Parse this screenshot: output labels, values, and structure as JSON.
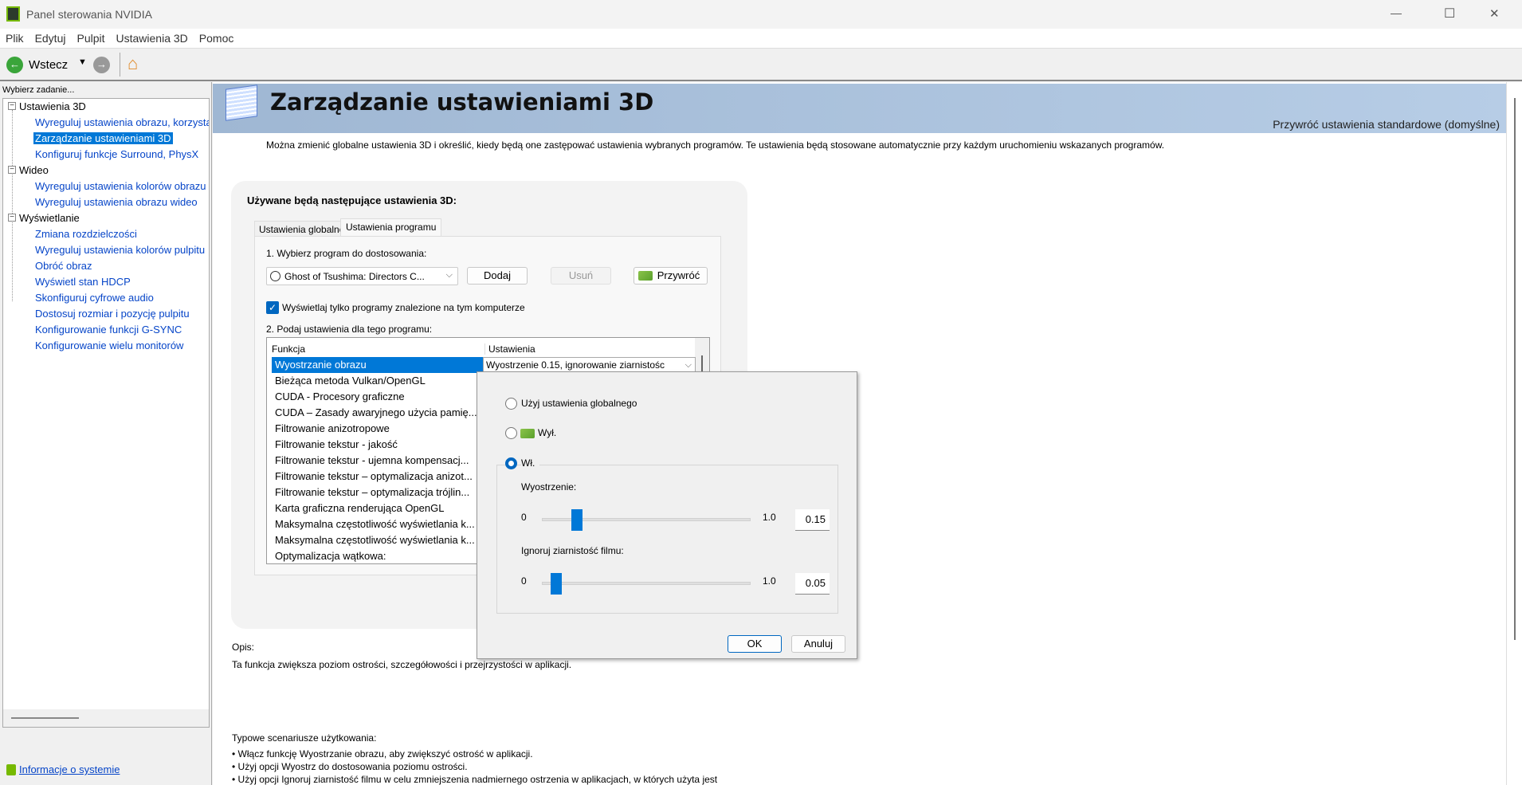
{
  "window": {
    "title": "Panel sterowania NVIDIA",
    "minimize": "—",
    "maximize": "☐",
    "close": "✕"
  },
  "menu": [
    "Plik",
    "Edytuj",
    "Pulpit",
    "Ustawienia 3D",
    "Pomoc"
  ],
  "toolbar": {
    "back": "Wstecz"
  },
  "sidebar": {
    "prompt": "Wybierz zadanie...",
    "groups": [
      {
        "label": "Ustawienia 3D",
        "items": [
          "Wyreguluj ustawienia obrazu, korzystając z podglądu",
          "Zarządzanie ustawieniami 3D",
          "Konfiguruj funkcje Surround, PhysX"
        ]
      },
      {
        "label": "Wideo",
        "items": [
          "Wyreguluj ustawienia kolorów obrazu",
          "Wyreguluj ustawienia obrazu wideo"
        ]
      },
      {
        "label": "Wyświetlanie",
        "items": [
          "Zmiana rozdzielczości",
          "Wyreguluj ustawienia kolorów pulpitu",
          "Obróć obraz",
          "Wyświetl stan HDCP",
          "Skonfiguruj cyfrowe audio",
          "Dostosuj rozmiar i pozycję pulpitu",
          "Konfigurowanie funkcji G-SYNC",
          "Konfigurowanie wielu monitorów"
        ]
      }
    ],
    "selected": "Zarządzanie ustawieniami 3D",
    "system_info": "Informacje o systemie"
  },
  "page": {
    "title": "Zarządzanie ustawieniami 3D",
    "restore_defaults": "Przywróć ustawienia standardowe (domyślne)",
    "intro": "Można zmienić globalne ustawienia 3D i określić, kiedy będą one zastępować ustawienia wybranych programów. Te ustawienia będą stosowane automatycznie przy każdym uruchomieniu wskazanych programów.",
    "panel_heading": "Używane będą następujące ustawienia 3D:",
    "tabs": [
      "Ustawienia globalne",
      "Ustawienia programu"
    ],
    "active_tab": "Ustawienia programu",
    "step1": "1. Wybierz program do dostosowania:",
    "program": "Ghost of Tsushima: Directors C...",
    "add": "Dodaj",
    "remove": "Usuń",
    "restore": "Przywróć",
    "only_found_label": "Wyświetlaj tylko programy znalezione na tym komputerze",
    "only_found_checked": true,
    "step2": "2. Podaj ustawienia dla tego programu:",
    "table": {
      "headers": [
        "Funkcja",
        "Ustawienia"
      ],
      "rows": [
        "Wyostrzanie obrazu",
        "Bieżąca metoda Vulkan/OpenGL",
        "CUDA - Procesory graficzne",
        "CUDA – Zasady awaryjnego użycia pamię...",
        "Filtrowanie anizotropowe",
        "Filtrowanie tekstur - jakość",
        "Filtrowanie tekstur - ujemna kompensacj...",
        "Filtrowanie tekstur – optymalizacja anizot...",
        "Filtrowanie tekstur – optymalizacja trójlin...",
        "Karta graficzna renderująca OpenGL",
        "Maksymalna częstotliwość wyświetlania k...",
        "Maksymalna częstotliwość wyświetlania k...",
        "Optymalizacja wątkowa:"
      ],
      "selected_value": "Wyostrzenie 0.15, ignorowanie ziarnistośc"
    },
    "description_label": "Opis:",
    "description": "Ta funkcja zwiększa poziom ostrości, szczegółowości i przejrzystości w aplikacji.",
    "scenarios_label": "Typowe scenariusze użytkowania:",
    "scenarios": [
      "• Włącz funkcję Wyostrzanie obrazu, aby zwiększyć ostrość w aplikacji.",
      "• Użyj opcji Wyostrz do dostosowania poziomu ostrości.",
      "• Użyj opcji Ignoruj ziarnistość filmu w celu zmniejszenia nadmiernego ostrzenia w aplikacjach, w których użyta jest"
    ]
  },
  "popup": {
    "opt_global": "Użyj ustawienia globalnego",
    "opt_off": "Wył.",
    "opt_on": "Wł.",
    "selected": "Wł.",
    "sharpen_label": "Wyostrzenie:",
    "sharpen_min": "0",
    "sharpen_max": "1.0",
    "sharpen_value": "0.15",
    "sharpen_fraction": 0.15,
    "grain_label": "Ignoruj ziarnistość filmu:",
    "grain_min": "0",
    "grain_max": "1.0",
    "grain_value": "0.05",
    "grain_fraction": 0.05,
    "ok": "OK",
    "cancel": "Anuluj"
  },
  "colors": {
    "accent": "#0078d7",
    "header": "#a7c0dc",
    "nvidia": "#76b900"
  }
}
